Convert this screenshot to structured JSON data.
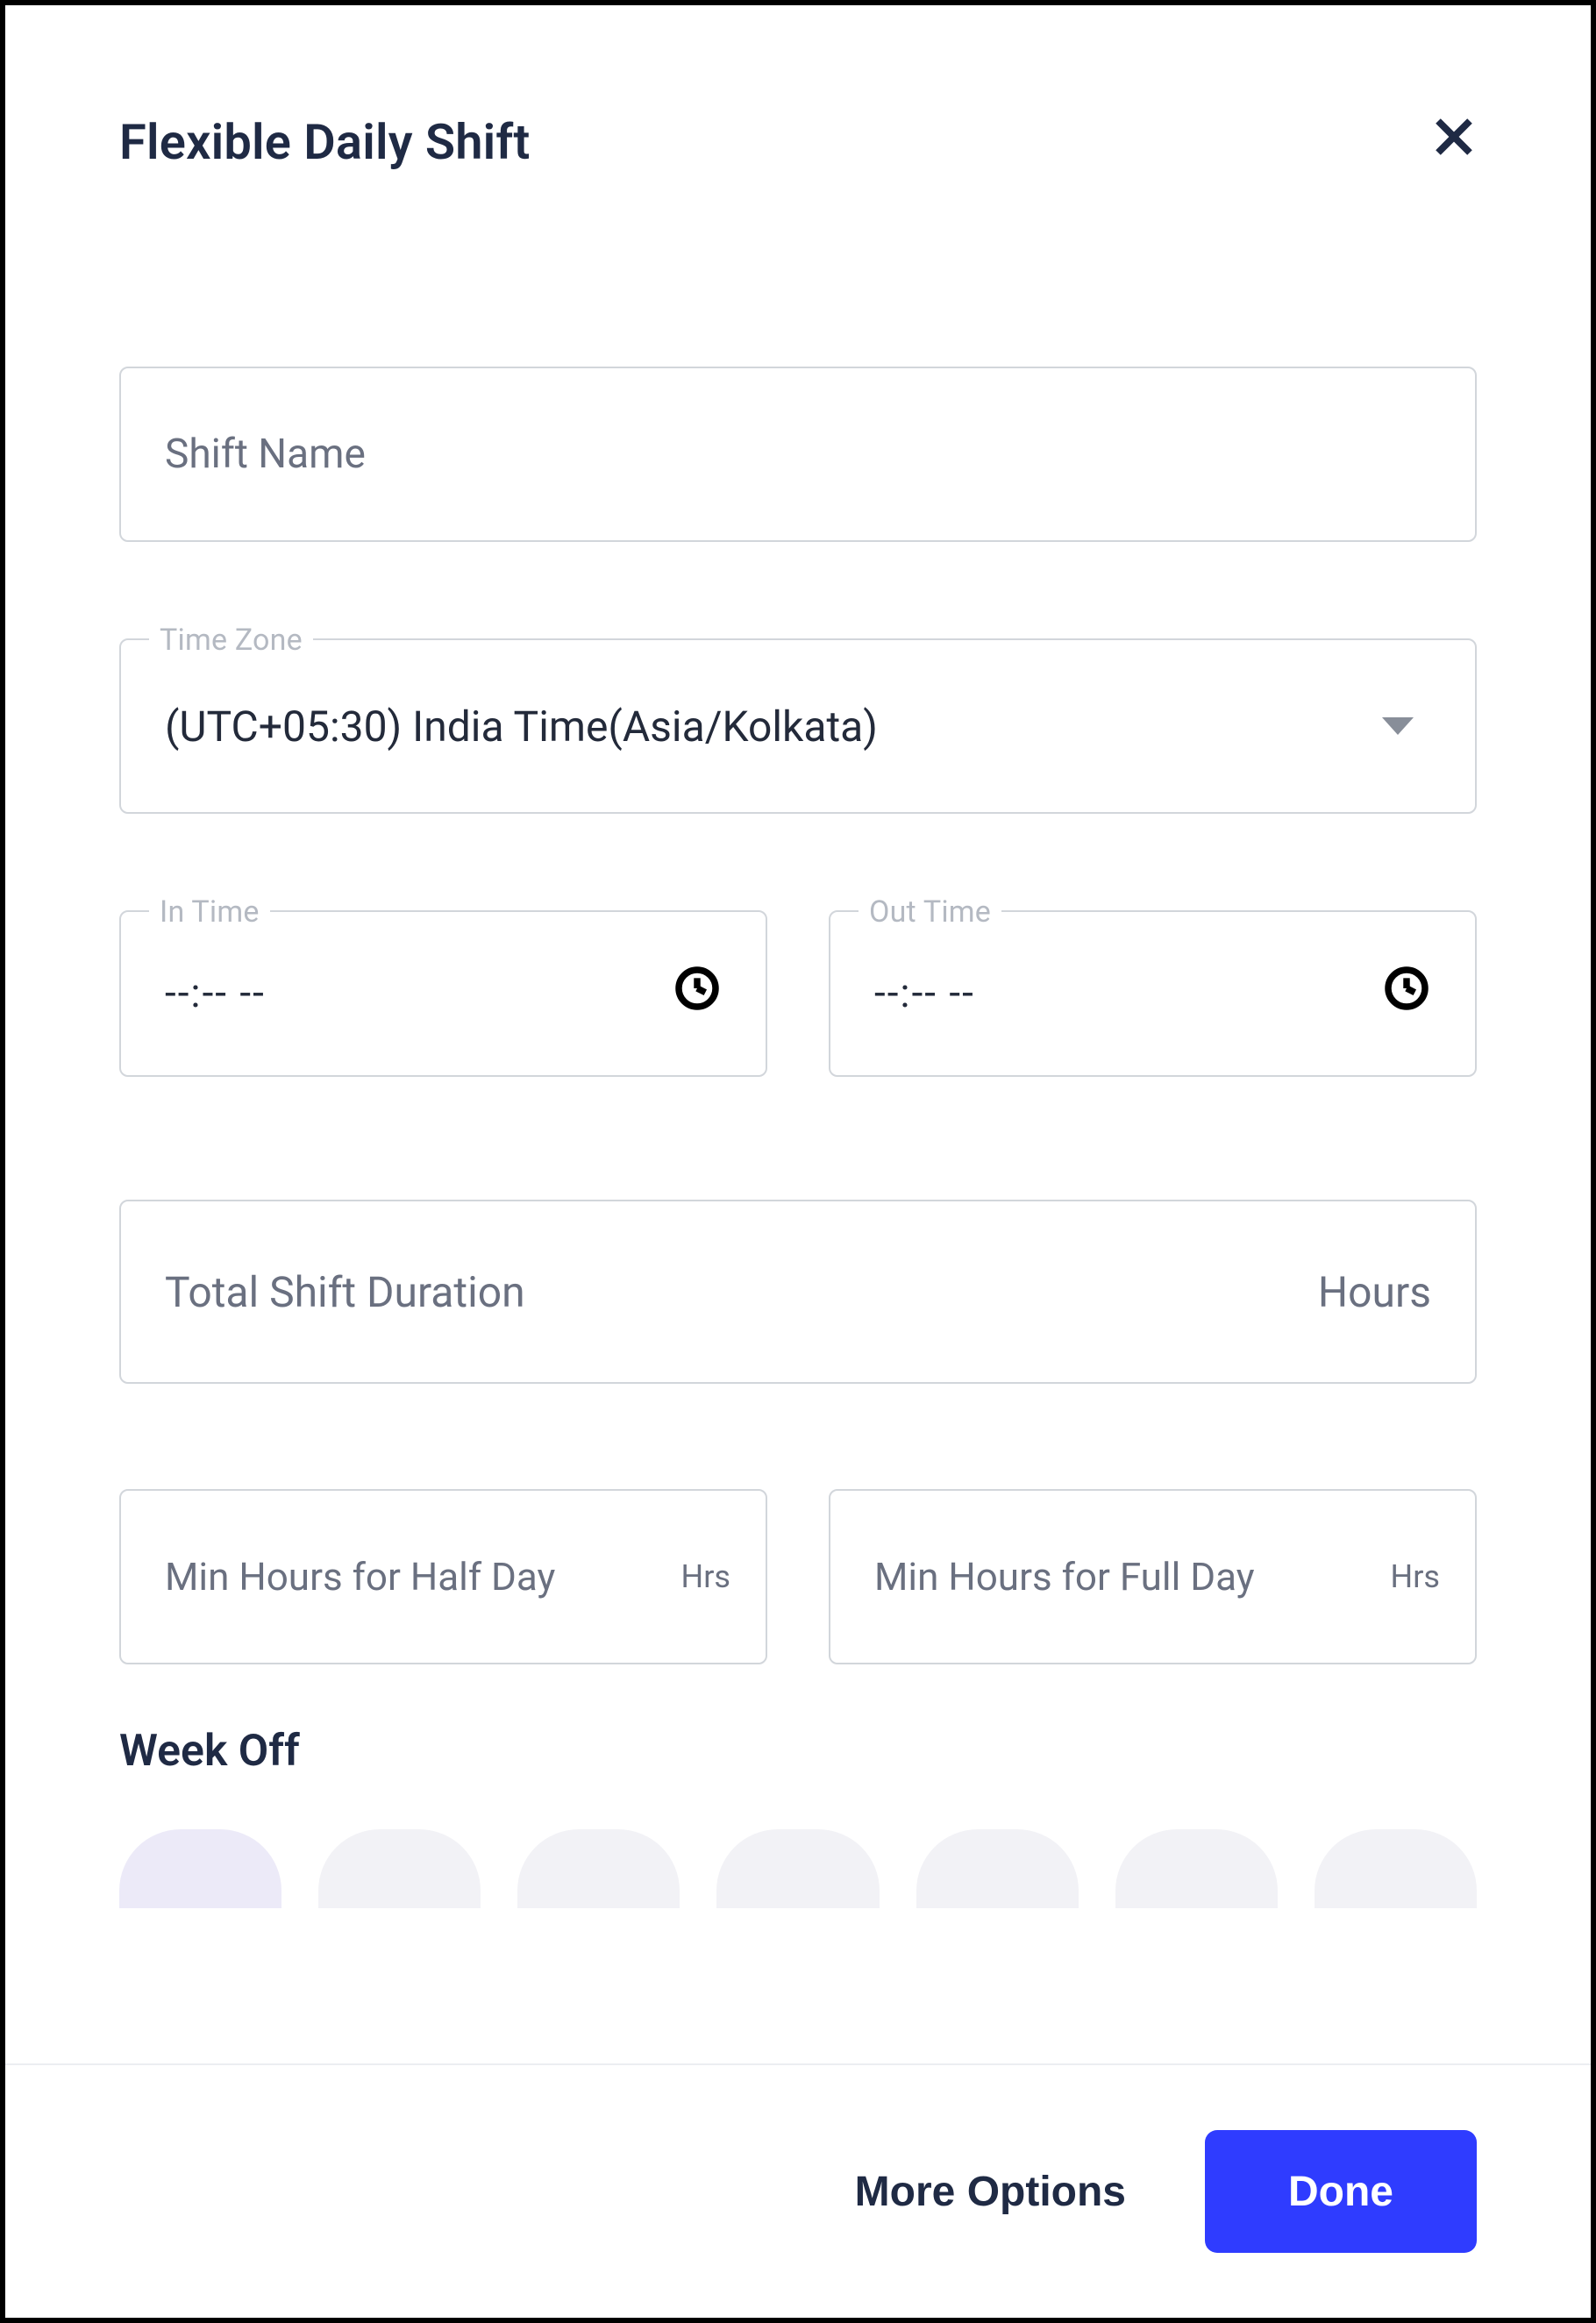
{
  "header": {
    "title": "Flexible Daily Shift"
  },
  "shift_name": {
    "placeholder": "Shift Name",
    "value": ""
  },
  "timezone": {
    "label": "Time Zone",
    "value": "(UTC+05:30) India Time(Asia/Kolkata)"
  },
  "in_time": {
    "label": "In Time",
    "placeholder": "--:--  --"
  },
  "out_time": {
    "label": "Out Time",
    "placeholder": "--:--  --"
  },
  "duration": {
    "label": "Total Shift Duration",
    "unit": "Hours"
  },
  "half_day": {
    "label": "Min Hours for Half Day",
    "unit": "Hrs"
  },
  "full_day": {
    "label": "Min Hours for Full Day",
    "unit": "Hrs"
  },
  "week_off": {
    "title": "Week Off"
  },
  "footer": {
    "more": "More Options",
    "done": "Done"
  }
}
